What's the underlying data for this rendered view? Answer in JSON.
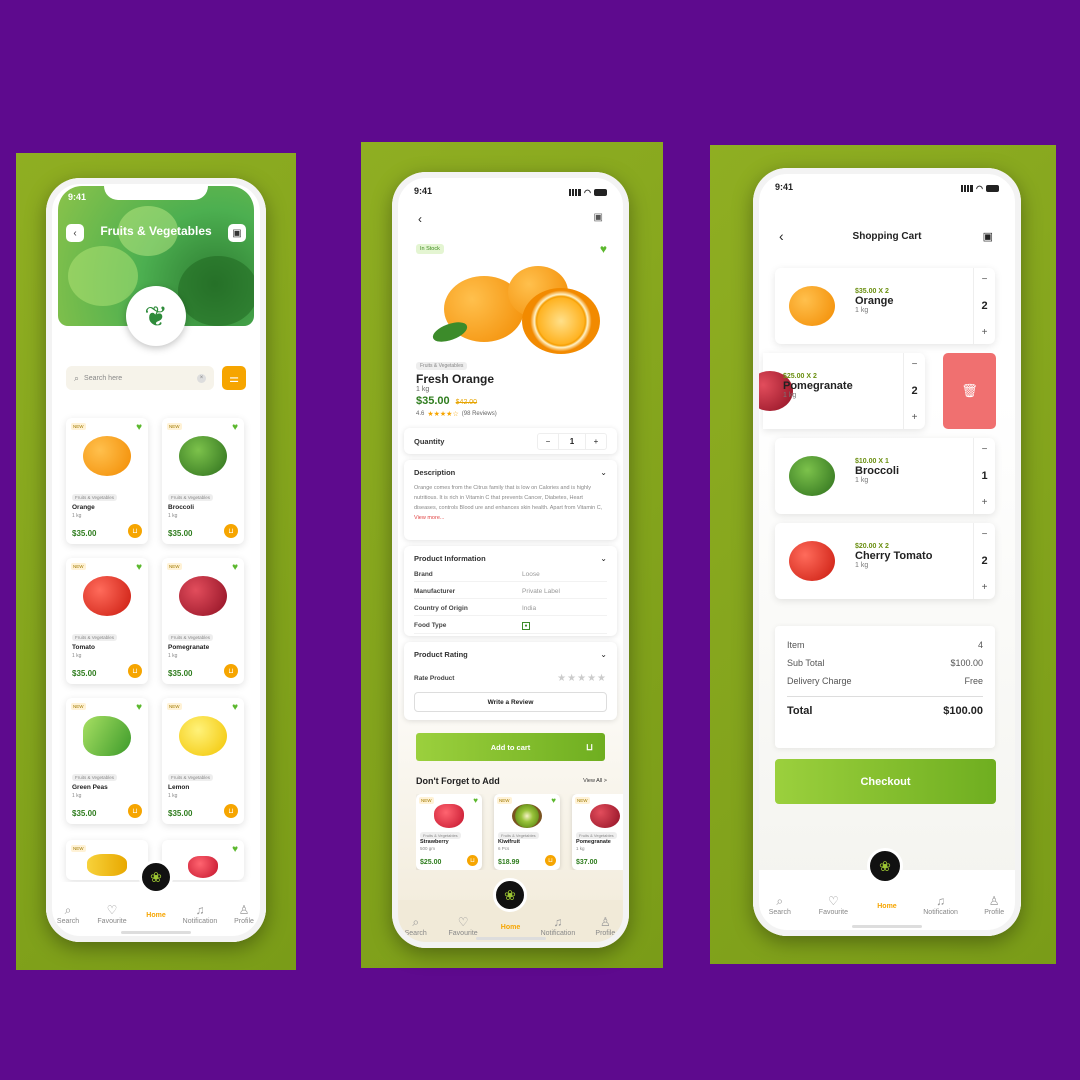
{
  "colors": {
    "background": "#5e0a8e",
    "panel": "#8fae22",
    "accent": "#f6a500",
    "green": "#6fae20",
    "delete": "#f07070"
  },
  "status": {
    "time": "9:41"
  },
  "tabs": [
    {
      "label": "Search",
      "icon": "search-icon"
    },
    {
      "label": "Favourite",
      "icon": "heart-icon"
    },
    {
      "label": "Home",
      "icon": "home-icon"
    },
    {
      "label": "Notification",
      "icon": "bell-icon"
    },
    {
      "label": "Profile",
      "icon": "user-icon"
    }
  ],
  "screen1": {
    "title": "Fruits & Vegetables",
    "search_placeholder": "Search here",
    "products": [
      {
        "badge": "NEW",
        "category": "Fruits & Vegetables",
        "name": "Orange",
        "qty": "1 kg",
        "price": "$35.00",
        "shape": "orange"
      },
      {
        "badge": "NEW",
        "category": "Fruits & Vegetables",
        "name": "Broccoli",
        "qty": "1 kg",
        "price": "$35.00",
        "shape": "broc"
      },
      {
        "badge": "NEW",
        "category": "Fruits & Vegetables",
        "name": "Tomato",
        "qty": "1 kg",
        "price": "$35.00",
        "shape": "tomato"
      },
      {
        "badge": "NEW",
        "category": "Fruits & Vegetables",
        "name": "Pomegranate",
        "qty": "1 kg",
        "price": "$35.00",
        "shape": "pome"
      },
      {
        "badge": "NEW",
        "category": "Fruits & Vegetables",
        "name": "Green Peas",
        "qty": "1 kg",
        "price": "$35.00",
        "shape": "peas"
      },
      {
        "badge": "NEW",
        "category": "Fruits & Vegetables",
        "name": "Lemon",
        "qty": "1 kg",
        "price": "$35.00",
        "shape": "lemon"
      }
    ]
  },
  "screen2": {
    "stock": "In Stock",
    "category": "Fruits & Vegetables",
    "name": "Fresh Orange",
    "qty": "1 kg",
    "price": "$35.00",
    "old_price": "$42.00",
    "rating": "4.6",
    "stars": "★★★★☆",
    "reviews": "(98 Reviews)",
    "quantity_label": "Quantity",
    "quantity_value": "1",
    "description_title": "Description",
    "description": "Orange comes from the Citrus family that is low on Calories and is highly nutritious. It is rich in Vitamin C that prevents Cancer, Diabetes, Heart diseases, controls Blood ure and enhances skin health. Apart from Vitamin C,",
    "view_more": "View more...",
    "info_title": "Product Information",
    "info": [
      {
        "key": "Brand",
        "value": "Loose"
      },
      {
        "key": "Manufacturer",
        "value": "Private Label"
      },
      {
        "key": "Country of Origin",
        "value": "India"
      },
      {
        "key": "Food Type",
        "value": ""
      }
    ],
    "rating_title": "Product Rating",
    "rate_label": "Rate Product",
    "empty_stars": "★★★★★",
    "review_button": "Write a Review",
    "add_to_cart": "Add to cart",
    "dont_forget": "Don't Forget to Add",
    "view_all": "View All >",
    "suggest": [
      {
        "badge": "NEW",
        "category": "Fruits & Vegetables",
        "name": "Strawberry",
        "qty": "500 gm",
        "price": "$25.00",
        "shape": "straw"
      },
      {
        "badge": "NEW",
        "category": "Fruits & Vegetables",
        "name": "Kiwifruit",
        "qty": "6 Pcs",
        "price": "$18.99",
        "shape": "kiwi"
      },
      {
        "badge": "NEW",
        "category": "Fruits & Vegetables",
        "name": "Pomegranate",
        "qty": "1 kg",
        "price": "$37.00",
        "shape": "pome"
      }
    ]
  },
  "screen3": {
    "title": "Shopping Cart",
    "items": [
      {
        "price_line": "$35.00 X 2",
        "name": "Orange",
        "qty": "1 kg",
        "count": "2",
        "shape": "orange"
      },
      {
        "price_line": "$25.00 X 2",
        "name": "Pomegranate",
        "qty": "1 kg",
        "count": "2",
        "shape": "pome"
      },
      {
        "price_line": "$10.00 X 1",
        "name": "Broccoli",
        "qty": "1 kg",
        "count": "1",
        "shape": "broc"
      },
      {
        "price_line": "$20.00 X 2",
        "name": "Cherry Tomato",
        "qty": "1 kg",
        "count": "2",
        "shape": "tomato"
      }
    ],
    "summary": {
      "item_label": "Item",
      "item_value": "4",
      "subtotal_label": "Sub Total",
      "subtotal_value": "$100.00",
      "delivery_label": "Delivery Charge",
      "delivery_value": "Free",
      "total_label": "Total",
      "total_value": "$100.00"
    },
    "checkout": "Checkout"
  }
}
